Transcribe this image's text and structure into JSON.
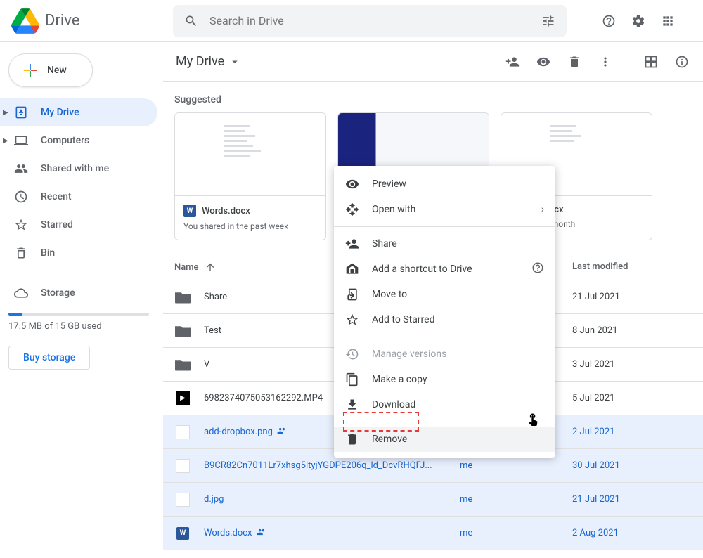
{
  "header": {
    "app_name": "Drive",
    "search_placeholder": "Search in Drive"
  },
  "sidebar": {
    "new_label": "New",
    "items": [
      {
        "label": "My Drive"
      },
      {
        "label": "Computers"
      },
      {
        "label": "Shared with me"
      },
      {
        "label": "Recent"
      },
      {
        "label": "Starred"
      },
      {
        "label": "Bin"
      }
    ],
    "storage_label": "Storage",
    "storage_used": "17.5 MB of 15 GB used",
    "buy_label": "Buy storage"
  },
  "toolbar": {
    "path": "My Drive"
  },
  "suggested": {
    "title": "Suggested",
    "cards": [
      {
        "title": "Words.docx",
        "sub": "You shared in the past week"
      },
      {
        "title": "",
        "sub": ""
      },
      {
        "title": "f Words.docx",
        "sub": "in the past month"
      }
    ]
  },
  "table": {
    "col_name": "Name",
    "col_owner": "",
    "col_date": "Last modified",
    "rows": [
      {
        "type": "folder",
        "name": "Share",
        "owner": "",
        "date": "21 Jul 2021",
        "selected": false
      },
      {
        "type": "folder",
        "name": "Test",
        "owner": "",
        "date": "8 Jun 2021",
        "selected": false
      },
      {
        "type": "folder-shared",
        "name": "V",
        "owner": "",
        "date": "3 Jul 2021",
        "selected": false
      },
      {
        "type": "video",
        "name": "6982374075053162292.MP4",
        "owner": "",
        "date": "5 Jul 2021",
        "selected": false
      },
      {
        "type": "image",
        "name": "add-dropbox.png",
        "owner": "",
        "date": "2 Jul 2021",
        "selected": true,
        "shared": true
      },
      {
        "type": "image",
        "name": "B9CR82Cn7011Lr7xhsg5ltyjYGDPE206q_ld_DcvRHQFJ...",
        "owner": "me",
        "date": "30 Jul 2021",
        "selected": true
      },
      {
        "type": "image",
        "name": "d.jpg",
        "owner": "me",
        "date": "21 Jul 2021",
        "selected": true
      },
      {
        "type": "docx",
        "name": "Words.docx",
        "owner": "me",
        "date": "2 Aug 2021",
        "selected": true,
        "shared": true
      }
    ]
  },
  "context_menu": {
    "preview": "Preview",
    "open_with": "Open with",
    "share": "Share",
    "shortcut": "Add a shortcut to Drive",
    "move": "Move to",
    "star": "Add to Starred",
    "versions": "Manage versions",
    "copy": "Make a copy",
    "download": "Download",
    "remove": "Remove"
  }
}
